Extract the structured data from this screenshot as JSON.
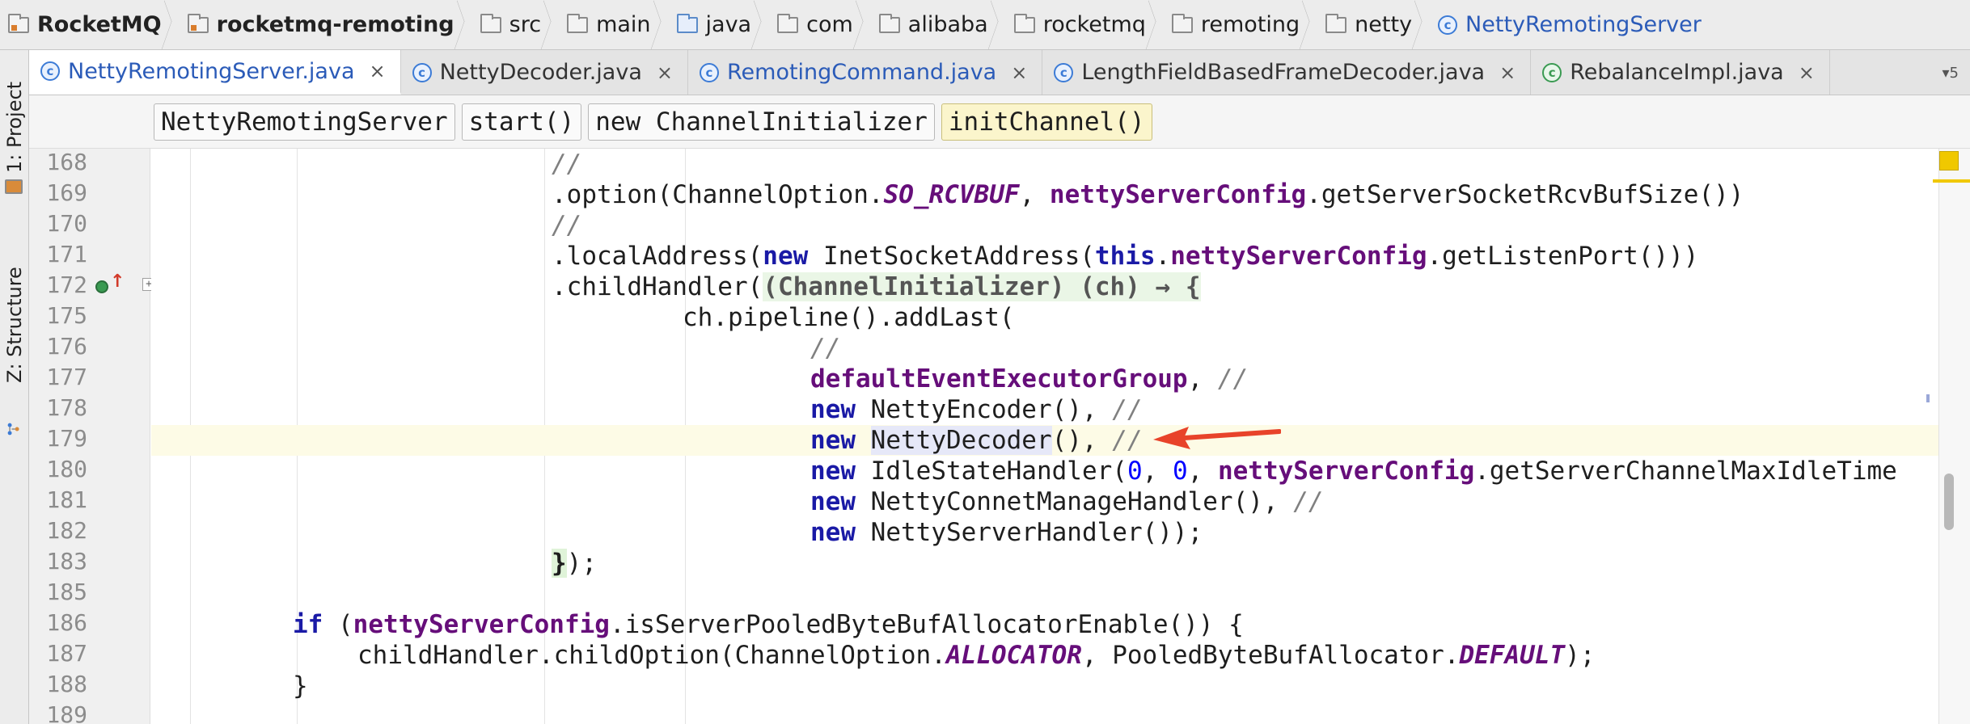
{
  "breadcrumb": [
    {
      "label": "RocketMQ",
      "icon": "module-folder-icon",
      "style": "bold"
    },
    {
      "label": "rocketmq-remoting",
      "icon": "module-folder-icon",
      "style": "bold"
    },
    {
      "label": "src",
      "icon": "folder-icon",
      "style": "plain"
    },
    {
      "label": "main",
      "icon": "folder-icon",
      "style": "plain"
    },
    {
      "label": "java",
      "icon": "source-folder-icon",
      "style": "plain"
    },
    {
      "label": "com",
      "icon": "folder-icon",
      "style": "plain"
    },
    {
      "label": "alibaba",
      "icon": "folder-icon",
      "style": "plain"
    },
    {
      "label": "rocketmq",
      "icon": "folder-icon",
      "style": "plain"
    },
    {
      "label": "remoting",
      "icon": "folder-icon",
      "style": "plain"
    },
    {
      "label": "netty",
      "icon": "folder-icon",
      "style": "plain"
    },
    {
      "label": "NettyRemotingServer",
      "icon": "class-icon",
      "style": "class"
    }
  ],
  "left_strip": {
    "project_tab": "1: Project",
    "structure_tab": "Z: Structure"
  },
  "tabs": [
    {
      "label": "NettyRemotingServer.java",
      "active": true,
      "color": "blue",
      "icon": "class-icon"
    },
    {
      "label": "NettyDecoder.java",
      "active": false,
      "color": "plain",
      "icon": "class-icon"
    },
    {
      "label": "RemotingCommand.java",
      "active": false,
      "color": "blue",
      "icon": "class-icon"
    },
    {
      "label": "LengthFieldBasedFrameDecoder.java",
      "active": false,
      "color": "plain",
      "icon": "locked-class-icon"
    },
    {
      "label": "RebalanceImpl.java",
      "active": false,
      "color": "plain",
      "icon": "abstract-class-icon"
    }
  ],
  "tab_close_glyph": "×",
  "tab_overflow": "▾5",
  "method_breadcrumb": [
    "NettyRemotingServer",
    "start()",
    "new ChannelInitializer",
    "initChannel()"
  ],
  "line_numbers": [
    "168",
    "169",
    "170",
    "171",
    "172",
    "175",
    "176",
    "177",
    "178",
    "179",
    "180",
    "181",
    "182",
    "183",
    "185",
    "186",
    "187",
    "188",
    "189"
  ],
  "current_line": "179",
  "colors": {
    "keyword": "#1a1aa6",
    "field": "#660e7a",
    "comment": "#808080",
    "number": "#0000ff",
    "current_row": "#fdfbe6",
    "annotation_arrow": "#e8432a"
  },
  "code": {
    "l168": {
      "cmt": "//"
    },
    "l169": {
      "a": ".option(ChannelOption.",
      "const": "SO_RCVBUF",
      "b": ", ",
      "field": "nettyServerConfig",
      "c": ".getServerSocketRcvBufSize())"
    },
    "l170": {
      "cmt": "//"
    },
    "l171": {
      "a": ".localAddress(",
      "kw1": "new",
      "b": " InetSocketAddress(",
      "kw2": "this",
      "c": ".",
      "field": "nettyServerConfig",
      "d": ".getListenPort()))"
    },
    "l172": {
      "a": ".childHandler(",
      "lambda": "(ChannelInitializer) (ch) → {"
    },
    "l175": {
      "a": "ch.pipeline().addLast("
    },
    "l176": {
      "cmt": "//"
    },
    "l177": {
      "field": "defaultEventExecutorGroup",
      "a": ", ",
      "cmt": "//"
    },
    "l178": {
      "kw": "new",
      "a": " NettyEncoder(), ",
      "cmt": "//"
    },
    "l179": {
      "kw": "new",
      "sp": " ",
      "hl": "NettyDecoder",
      "a": "(), ",
      "cmt": "//"
    },
    "l180": {
      "kw": "new",
      "a": " IdleStateHandler(",
      "n1": "0",
      "b": ", ",
      "n2": "0",
      "c": ", ",
      "field": "nettyServerConfig",
      "d": ".getServerChannelMaxIdleTime"
    },
    "l181": {
      "kw": "new",
      "a": " NettyConnetManageHandler(), ",
      "cmt": "//"
    },
    "l182": {
      "kw": "new",
      "a": " NettyServerHandler());"
    },
    "l183": {
      "brace": "}",
      "a": ");"
    },
    "l186": {
      "kw": "if",
      "a": " (",
      "field": "nettyServerConfig",
      "b": ".isServerPooledByteBufAllocatorEnable()) {"
    },
    "l187": {
      "a": "childHandler.childOption(ChannelOption.",
      "const1": "ALLOCATOR",
      "b": ", PooledByteBufAllocator.",
      "const2": "DEFAULT",
      "c": ");"
    },
    "l188": {
      "a": "}"
    }
  }
}
